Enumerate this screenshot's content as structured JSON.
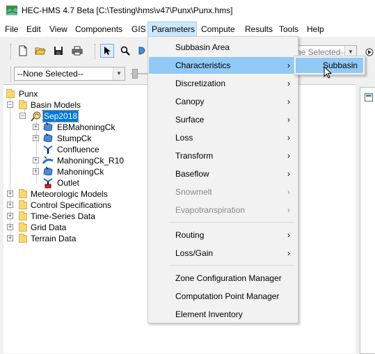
{
  "window": {
    "title": "HEC-HMS 4.7 Beta [C:\\Testing\\hms\\v47\\Punx\\Punx.hms]"
  },
  "menubar": [
    "File",
    "Edit",
    "View",
    "Components",
    "GIS",
    "Parameters",
    "Compute",
    "Results",
    "Tools",
    "Help"
  ],
  "toolbar": {
    "basin_combo": "--None Selected--",
    "run_combo": "ne Selected--"
  },
  "tree": {
    "root": "Punx",
    "basin_models": "Basin Models",
    "basin": "Sep2018",
    "elements": [
      "EBMahoningCk",
      "StumpCk",
      "Confluence",
      "MahoningCk_R10",
      "MahoningCk",
      "Outlet"
    ],
    "folders": [
      "Meteorologic Models",
      "Control Specifications",
      "Time-Series Data",
      "Grid Data",
      "Terrain Data"
    ]
  },
  "parameters_menu": {
    "items": [
      {
        "label": "Subbasin Area",
        "submenu": false
      },
      {
        "label": "Characteristics",
        "submenu": true
      },
      {
        "label": "Discretization",
        "submenu": true
      },
      {
        "label": "Canopy",
        "submenu": true
      },
      {
        "label": "Surface",
        "submenu": true
      },
      {
        "label": "Loss",
        "submenu": true
      },
      {
        "label": "Transform",
        "submenu": true
      },
      {
        "label": "Baseflow",
        "submenu": true
      },
      {
        "label": "Snowmelt",
        "submenu": true,
        "disabled": true
      },
      {
        "label": "Evapotranspiration",
        "submenu": true,
        "disabled": true
      },
      {
        "label": "Routing",
        "submenu": true
      },
      {
        "label": "Loss/Gain",
        "submenu": true
      },
      {
        "label": "Zone Configuration Manager",
        "submenu": false
      },
      {
        "label": "Computation Point Manager",
        "submenu": false
      },
      {
        "label": "Element Inventory",
        "submenu": false
      }
    ],
    "submenu_arrow": "›",
    "characteristics_submenu": [
      "Subbasin"
    ]
  }
}
